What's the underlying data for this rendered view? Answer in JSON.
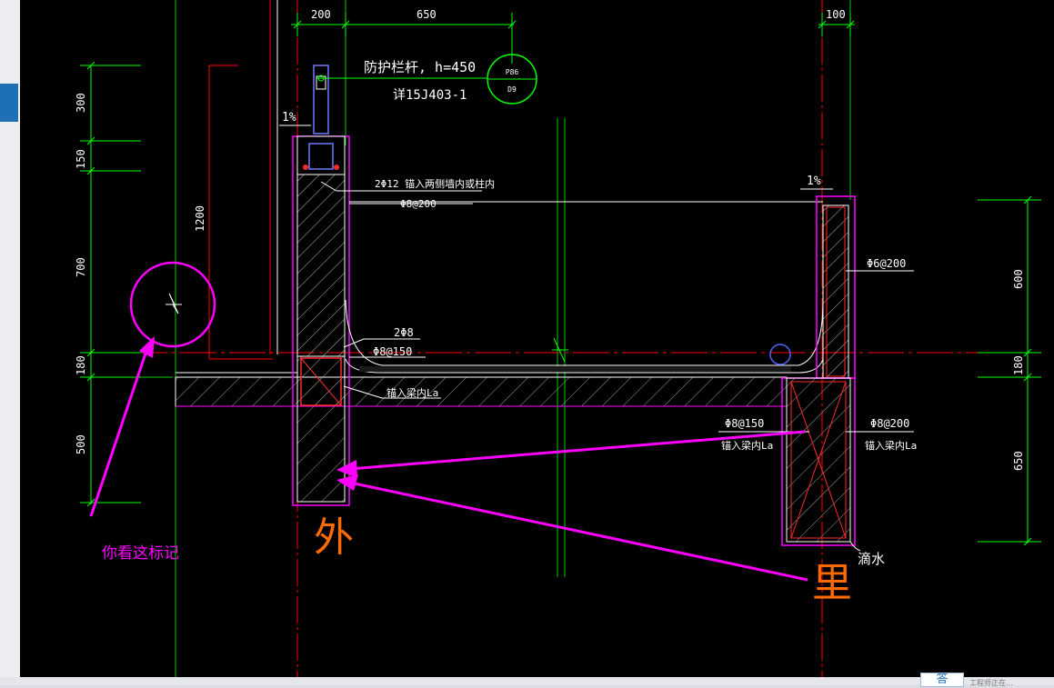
{
  "dimensions": {
    "top": [
      "200",
      "650",
      "100"
    ],
    "left": [
      "300",
      "150",
      "700",
      "180",
      "500"
    ],
    "height_1200": "1200",
    "right": [
      "600",
      "180",
      "650"
    ]
  },
  "labels": {
    "railing": "防护栏杆, h=450",
    "railing_detail": "详15J403-1",
    "callout_top": "P86",
    "callout_bottom": "D9",
    "slope_left": "1%",
    "slope_right": "1%",
    "bar_2phi12": "2Φ12  锚入两侧墙内或柱内",
    "phi8_200_top": "Φ8@200",
    "phi6_200": "Φ6@200",
    "bar_2phi8": "2Φ8",
    "phi8_150_left": "Φ8@150",
    "anchor_la_left": "锚入梁内La",
    "phi8_150_right": "Φ8@150",
    "anchor_la_right1": "锚入梁内La",
    "phi8_200_right": "Φ8@200",
    "anchor_la_right2": "锚入梁内La",
    "drip": "滴水"
  },
  "annotations": {
    "look_here": "你看这标记",
    "outside": "外",
    "inside": "里"
  },
  "bottom_bar": {
    "icon_text": "答",
    "hint": "工程师正在..."
  },
  "colors": {
    "background": "#000000",
    "dimension": "#00ff00",
    "outline": "#ff00ff",
    "annotation": "#ff00ff",
    "chinese_marker": "#ff6a00",
    "axis_red": "#ff0000",
    "cad_text": "#ffffff"
  }
}
